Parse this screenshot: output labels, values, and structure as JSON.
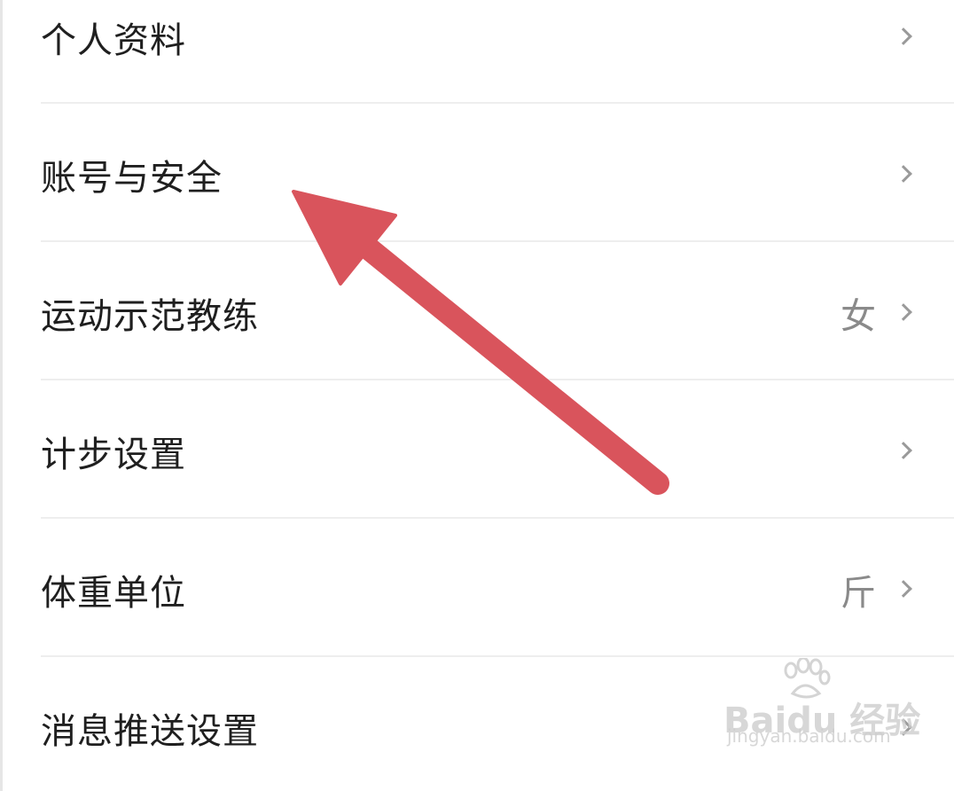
{
  "settings": {
    "items": [
      {
        "label": "个人资料",
        "value": ""
      },
      {
        "label": "账号与安全",
        "value": ""
      },
      {
        "label": "运动示范教练",
        "value": "女"
      },
      {
        "label": "计步设置",
        "value": ""
      },
      {
        "label": "体重单位",
        "value": "斤"
      },
      {
        "label": "消息推送设置",
        "value": ""
      }
    ]
  },
  "annotation": {
    "arrow_color": "#d9545c"
  },
  "watermark": {
    "brand": "Baidu 经验",
    "url": "jingyan.baidu.com"
  },
  "colors": {
    "label": "#1f1f1f",
    "value": "#8a8a8a",
    "chevron": "#9a9a9a",
    "divider": "#eeeeee"
  }
}
